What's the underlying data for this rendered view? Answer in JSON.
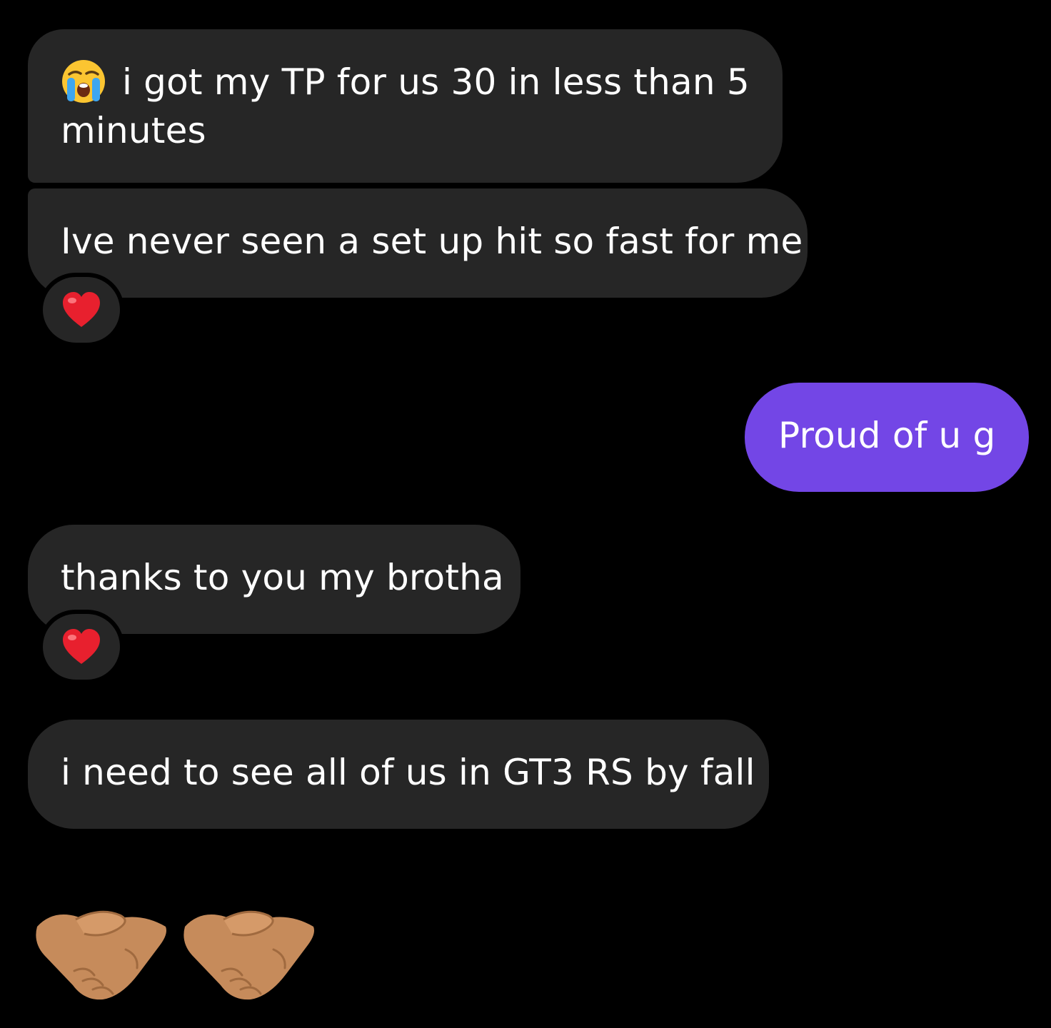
{
  "messages": [
    {
      "direction": "incoming",
      "emoji": "loudly-crying-face",
      "text": "i got my TP for us 30 in less than 5 minutes"
    },
    {
      "direction": "incoming",
      "text": "Ive never seen a set up hit so fast for me",
      "reaction": "red-heart"
    },
    {
      "direction": "outgoing",
      "text": "Proud of u g"
    },
    {
      "direction": "incoming",
      "text": "thanks to you my brotha",
      "reaction": "red-heart"
    },
    {
      "direction": "incoming",
      "text": "i need to see all of us in GT3 RS by fall"
    },
    {
      "direction": "incoming",
      "emoji_only": [
        "handshake",
        "handshake"
      ]
    }
  ],
  "colors": {
    "background": "#000000",
    "incoming_bubble": "#262626",
    "outgoing_bubble": "#7346e6",
    "text": "#ffffff",
    "heart": "#e8202e"
  }
}
